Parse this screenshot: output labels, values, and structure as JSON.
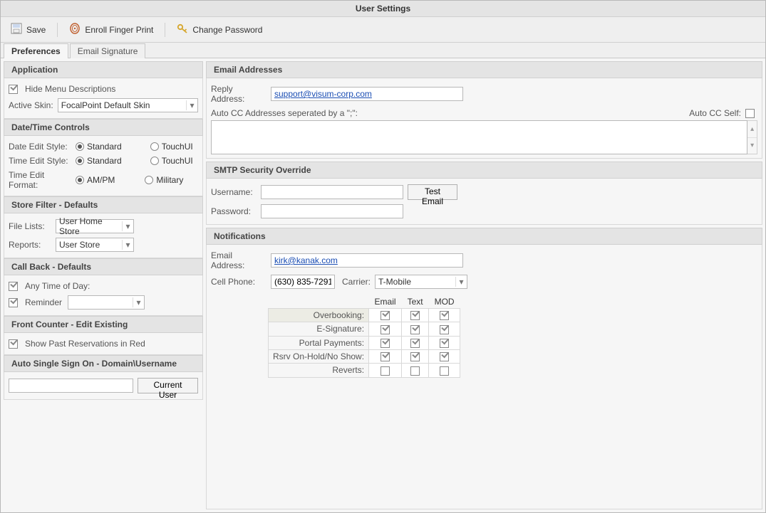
{
  "title": "User Settings",
  "toolbar": {
    "save": "Save",
    "enroll": "Enroll Finger Print",
    "change_pw": "Change Password"
  },
  "tabs": {
    "preferences": "Preferences",
    "email_sig": "Email Signature"
  },
  "left": {
    "application": {
      "header": "Application",
      "hide_menu_label": "Hide Menu Descriptions",
      "hide_menu_checked": true,
      "active_skin_label": "Active Skin:",
      "active_skin_value": "FocalPoint Default Skin"
    },
    "datetime": {
      "header": "Date/Time Controls",
      "date_edit_label": "Date Edit Style:",
      "time_edit_label": "Time Edit Style:",
      "time_fmt_label": "Time Edit Format:",
      "opt_standard": "Standard",
      "opt_touchui": "TouchUI",
      "opt_ampm": "AM/PM",
      "opt_military": "Military"
    },
    "storefilter": {
      "header": "Store Filter - Defaults",
      "file_lists_label": "File Lists:",
      "file_lists_value": "User Home Store",
      "reports_label": "Reports:",
      "reports_value": "User Store"
    },
    "callback": {
      "header": "Call Back - Defaults",
      "any_time_label": "Any Time of Day:",
      "any_time_checked": true,
      "reminder_label": "Reminder",
      "reminder_checked": true,
      "reminder_value": ""
    },
    "frontcounter": {
      "header": "Front Counter - Edit Existing",
      "show_past_label": "Show Past Reservations in Red",
      "show_past_checked": true
    },
    "sso": {
      "header": "Auto Single Sign On - Domain\\Username",
      "value": "",
      "button": "Current User"
    }
  },
  "right": {
    "email": {
      "header": "Email Addresses",
      "reply_label": "Reply Address:",
      "reply_value": "support@visum-corp.com",
      "autocc_label": "Auto CC Addresses seperated by a \";\":",
      "autocc_self_label": "Auto CC Self:",
      "autocc_self_checked": false,
      "autocc_value": ""
    },
    "smtp": {
      "header": "SMTP Security Override",
      "username_label": "Username:",
      "username_value": "",
      "password_label": "Password:",
      "password_value": "",
      "test_button": "Test Email"
    },
    "notif": {
      "header": "Notifications",
      "email_label": "Email Address:",
      "email_value": "kirk@kanak.com",
      "cell_label": "Cell Phone:",
      "cell_value": "(630) 835-7291",
      "carrier_label": "Carrier:",
      "carrier_value": "T-Mobile",
      "col_email": "Email",
      "col_text": "Text",
      "col_mod": "MOD",
      "rows": [
        {
          "label": "Overbooking:",
          "email": true,
          "text": true,
          "mod": true,
          "hl": true
        },
        {
          "label": "E-Signature:",
          "email": true,
          "text": true,
          "mod": true
        },
        {
          "label": "Portal Payments:",
          "email": true,
          "text": true,
          "mod": true
        },
        {
          "label": "Rsrv On-Hold/No Show:",
          "email": true,
          "text": true,
          "mod": true
        },
        {
          "label": "Reverts:",
          "email": false,
          "text": false,
          "mod": false
        }
      ]
    }
  }
}
